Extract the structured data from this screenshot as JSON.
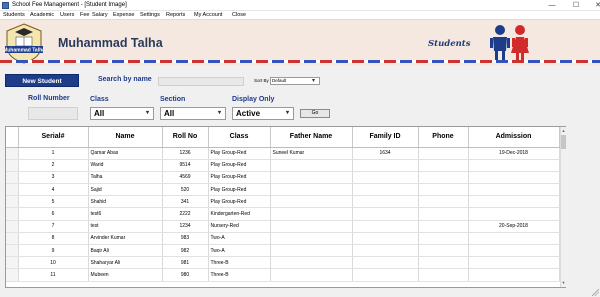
{
  "window": {
    "title": "School Fee Management - [Student Image]",
    "minimize": "—",
    "maximize": "☐",
    "close": "✕"
  },
  "menu": [
    "Students",
    "Academic",
    "Users",
    "Fee",
    "Salary",
    "Expense",
    "Settings",
    "Reports",
    "My Account",
    "Close"
  ],
  "header": {
    "logo_text": "Muhammad Talha",
    "student_name": "Muhammad Talha",
    "caption": "Students"
  },
  "toolbar": {
    "new_student_label": "New Student",
    "search_label": "Search by name",
    "search_value": "",
    "sort_label": "Sort By",
    "sort_value": "Default"
  },
  "filters": {
    "roll_label": "Roll Number",
    "roll_value": "",
    "class_label": "Class",
    "class_value": "All",
    "section_label": "Section",
    "section_value": "All",
    "display_label": "Display Only",
    "display_value": "Active",
    "go_label": "Go"
  },
  "table": {
    "columns": [
      "Serial#",
      "Name",
      "Roll No",
      "Class",
      "Father Name",
      "Family ID",
      "Phone",
      "Admission"
    ],
    "rows": [
      [
        "1",
        "Qamar Abas",
        "1236",
        "Play Group-Red",
        "Suneel Kumar",
        "1634",
        "",
        "19-Dec-2018"
      ],
      [
        "2",
        "Warid",
        "9514",
        "Play Group-Red",
        "",
        "",
        "",
        ""
      ],
      [
        "3",
        "Talha",
        "4569",
        "Play Group-Red",
        "",
        "",
        "",
        ""
      ],
      [
        "4",
        "Sajid",
        "520",
        "Play Group-Red",
        "",
        "",
        "",
        ""
      ],
      [
        "5",
        "Shahid",
        "341",
        "Play Group-Red",
        "",
        "",
        "",
        ""
      ],
      [
        "6",
        "test6",
        "2222",
        "Kindergarten-Red",
        "",
        "",
        "",
        ""
      ],
      [
        "7",
        "test",
        "1234",
        "Nursery-Red",
        "",
        "",
        "",
        "20-Sep-2018"
      ],
      [
        "8",
        "Arvinder Kumar",
        "983",
        "Two-A",
        "",
        "",
        "",
        ""
      ],
      [
        "9",
        "Baqir Ali",
        "982",
        "Two-A",
        "",
        "",
        "",
        ""
      ],
      [
        "10",
        "Shaharyar Ali",
        "981",
        "Three-B",
        "",
        "",
        "",
        ""
      ],
      [
        "11",
        "Mubeen",
        "980",
        "Three-B",
        "",
        "",
        "",
        ""
      ]
    ]
  },
  "colors": {
    "accent": "#1d3c8a",
    "header_bg": "#f5e8e0",
    "label_blue": "#1f3a8a"
  }
}
